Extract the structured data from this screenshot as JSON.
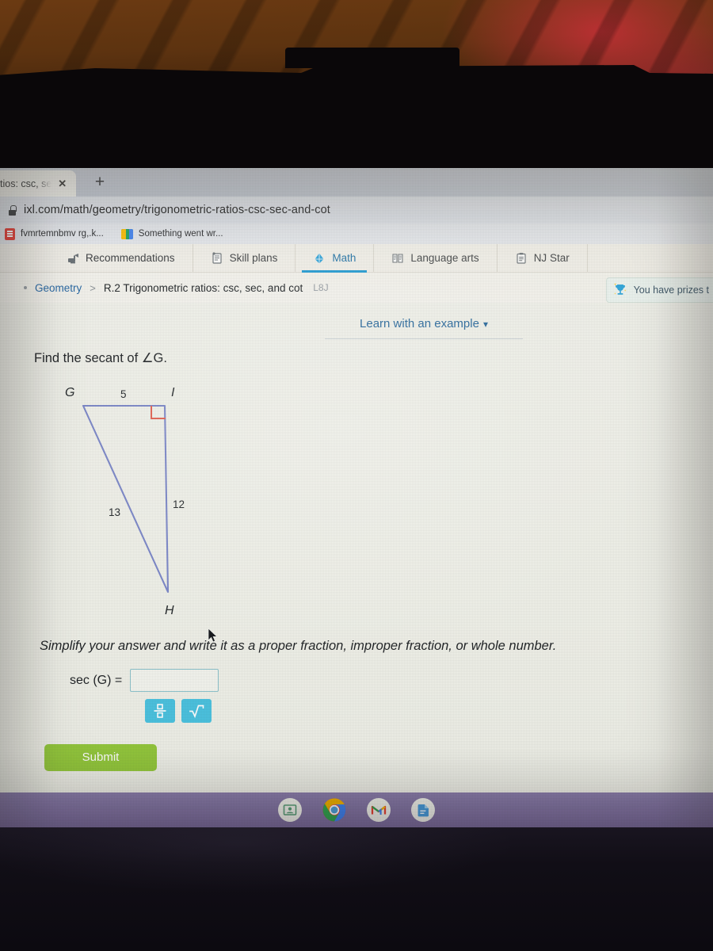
{
  "browser": {
    "tab": {
      "title": "tios: csc, se",
      "close_label": "✕"
    },
    "new_tab_label": "+",
    "url": "ixl.com/math/geometry/trigonometric-ratios-csc-sec-and-cot",
    "bookmarks": [
      {
        "label": "fvmrtemnbmv rg,.k...",
        "icon": "red-doc-icon"
      },
      {
        "label": "Something went wr...",
        "icon": "google-classroom-icon"
      }
    ]
  },
  "ixl_nav": {
    "items": [
      {
        "label": "Recommendations",
        "icon": "recommendations-icon",
        "active": false
      },
      {
        "label": "Skill plans",
        "icon": "skill-plans-icon",
        "active": false
      },
      {
        "label": "Math",
        "icon": "math-icon",
        "active": true
      },
      {
        "label": "Language arts",
        "icon": "language-arts-icon",
        "active": false
      },
      {
        "label": "NJ Star",
        "icon": "standards-icon",
        "active": false
      }
    ]
  },
  "breadcrumb": {
    "subject": "Geometry",
    "separator": ">",
    "skill": "R.2 Trigonometric ratios: csc, sec, and cot",
    "skill_code": "L8J"
  },
  "prizes_banner": {
    "text": "You have prizes t",
    "icon": "trophy-icon"
  },
  "lesson": {
    "learn_link": "Learn with an example",
    "learn_chevron": "⌄",
    "question": "Find the secant of ∠G.",
    "instruction": "Simplify your answer and write it as a proper fraction, improper fraction, or whole number.",
    "answer_label": "sec (G)  =",
    "answer_value": "",
    "answer_placeholder": "",
    "keypad": [
      {
        "name": "fraction-key",
        "glyph": "fraction"
      },
      {
        "name": "radical-key",
        "glyph": "radical"
      }
    ],
    "submit_label": "Submit"
  },
  "figure": {
    "type": "right-triangle",
    "vertices": [
      {
        "label": "G",
        "position": "top-left"
      },
      {
        "label": "I",
        "position": "top-right"
      },
      {
        "label": "H",
        "position": "bottom"
      }
    ],
    "sides": [
      {
        "label": "5",
        "between": "G-I",
        "position": "top"
      },
      {
        "label": "12",
        "between": "I-H",
        "position": "right"
      },
      {
        "label": "13",
        "between": "G-H",
        "position": "left"
      }
    ],
    "right_angle_at": "I",
    "line_color": "#7b87c9",
    "right_angle_color": "#e2604f"
  },
  "shelf": {
    "icons": [
      {
        "name": "google-classroom-shelf-icon"
      },
      {
        "name": "chrome-shelf-icon"
      },
      {
        "name": "gmail-shelf-icon"
      },
      {
        "name": "google-drive-shelf-icon"
      }
    ]
  },
  "colors": {
    "accent_blue": "#1f9bd4",
    "link_blue": "#2b6b9e",
    "submit_green": "#94c83d",
    "keypad_cyan": "#4cc3e0",
    "shelf_purple": "#7f6fa1"
  }
}
